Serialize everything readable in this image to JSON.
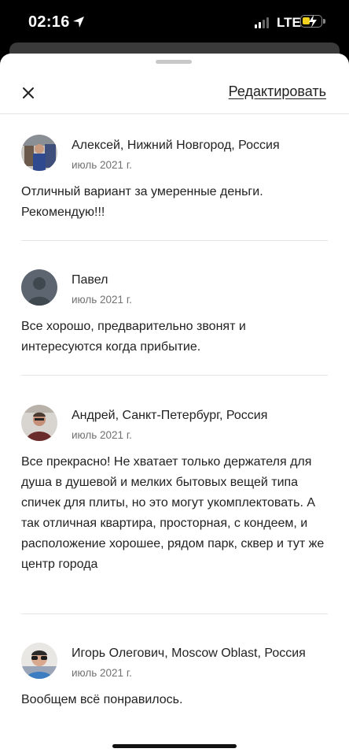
{
  "status_bar": {
    "time": "02:16",
    "network": "LTE",
    "battery_color": "#f3d21f"
  },
  "header": {
    "edit_label": "Редактировать"
  },
  "reviews": [
    {
      "author": "Алексей, Нижний Новгород, Россия",
      "date": "июль 2021 г.",
      "text": "Отличный вариант за умеренные деньги. Рекомендую!!!"
    },
    {
      "author": "Павел",
      "date": "июль 2021 г.",
      "text": "Все хорошо, предварительно звонят и интересуются когда прибытие."
    },
    {
      "author": "Андрей, Санкт-Петербург, Россия",
      "date": "июль 2021 г.",
      "text": "Все прекрасно! Не хватает только держателя для душа в душевой и мелких бытовых вещей типа спичек для плиты, но это могут укомплектовать. А так отличная квартира, просторная, с кондеем, и расположение хорошее, рядом парк, сквер и тут же центр города"
    },
    {
      "author": "Игорь Олегович, Moscow Oblast, Россия",
      "date": "июль 2021 г.",
      "text": "Вообщем всё  понравилось."
    }
  ]
}
